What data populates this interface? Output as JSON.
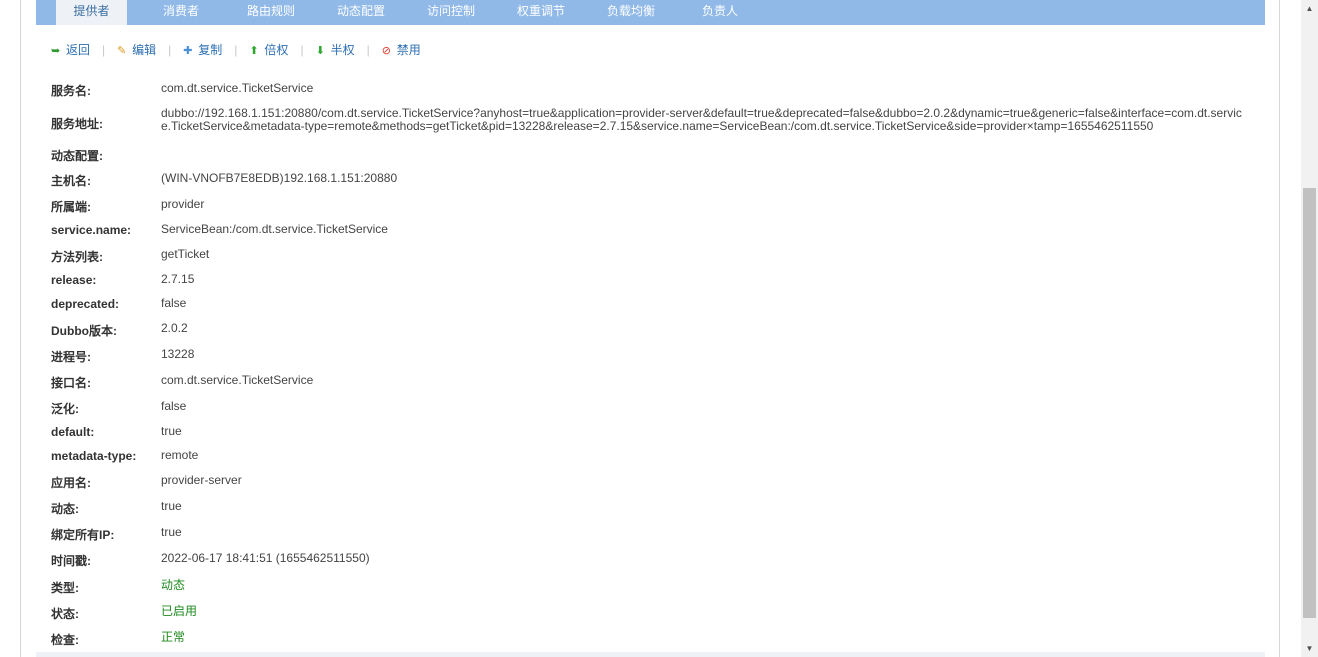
{
  "tabs": [
    {
      "label": "提供者",
      "active": true
    },
    {
      "label": "消费者"
    },
    {
      "label": "路由规则"
    },
    {
      "label": "动态配置"
    },
    {
      "label": "访问控制"
    },
    {
      "label": "权重调节"
    },
    {
      "label": "负载均衡"
    },
    {
      "label": "负责人"
    }
  ],
  "toolbar": {
    "back": "返回",
    "edit": "编辑",
    "copy": "复制",
    "double": "倍权",
    "half": "半权",
    "disable": "禁用",
    "separator": "|",
    "icons": [
      "back-icon",
      "edit-icon",
      "copy-icon",
      "arrow-up-icon",
      "arrow-down-icon",
      "ban-icon"
    ]
  },
  "details": [
    {
      "label": "服务名:",
      "value": "com.dt.service.TicketService"
    },
    {
      "label": "服务地址:",
      "value": "dubbo://192.168.1.151:20880/com.dt.service.TicketService?anyhost=true&application=provider-server&default=true&deprecated=false&dubbo=2.0.2&dynamic=true&generic=false&interface=com.dt.service.TicketService&metadata-type=remote&methods=getTicket&pid=13228&release=2.7.15&service.name=ServiceBean:/com.dt.service.TicketService&side=provider×tamp=1655462511550"
    },
    {
      "label": "动态配置:",
      "value": ""
    },
    {
      "label": "主机名:",
      "value": "(WIN-VNOFB7E8EDB)192.168.1.151:20880"
    },
    {
      "label": "所属端:",
      "value": "provider"
    },
    {
      "label": "service.name:",
      "value": "ServiceBean:/com.dt.service.TicketService"
    },
    {
      "label": "方法列表:",
      "value": "getTicket"
    },
    {
      "label": "release:",
      "value": "2.7.15"
    },
    {
      "label": "deprecated:",
      "value": "false"
    },
    {
      "label": "Dubbo版本:",
      "value": "2.0.2"
    },
    {
      "label": "进程号:",
      "value": "13228"
    },
    {
      "label": "接口名:",
      "value": "com.dt.service.TicketService"
    },
    {
      "label": "泛化:",
      "value": "false"
    },
    {
      "label": "default:",
      "value": "true"
    },
    {
      "label": "metadata-type:",
      "value": "remote"
    },
    {
      "label": "应用名:",
      "value": "provider-server"
    },
    {
      "label": "动态:",
      "value": "true"
    },
    {
      "label": "绑定所有IP:",
      "value": "true"
    },
    {
      "label": "时间戳:",
      "value": "2022-06-17 18:41:51 (1655462511550)"
    },
    {
      "label": "类型:",
      "value": "动态",
      "status": true
    },
    {
      "label": "状态:",
      "value": "已启用",
      "status": true
    },
    {
      "label": "检查:",
      "value": "正常",
      "status": true
    }
  ],
  "colors": {
    "tabbar": "#90b9e8",
    "active_tab": "#eef1f5",
    "link": "#2e6fb1",
    "status_green": "#1f8a1f"
  },
  "scrollbar": {
    "up_arrow": "▲",
    "down_arrow": "▼"
  }
}
